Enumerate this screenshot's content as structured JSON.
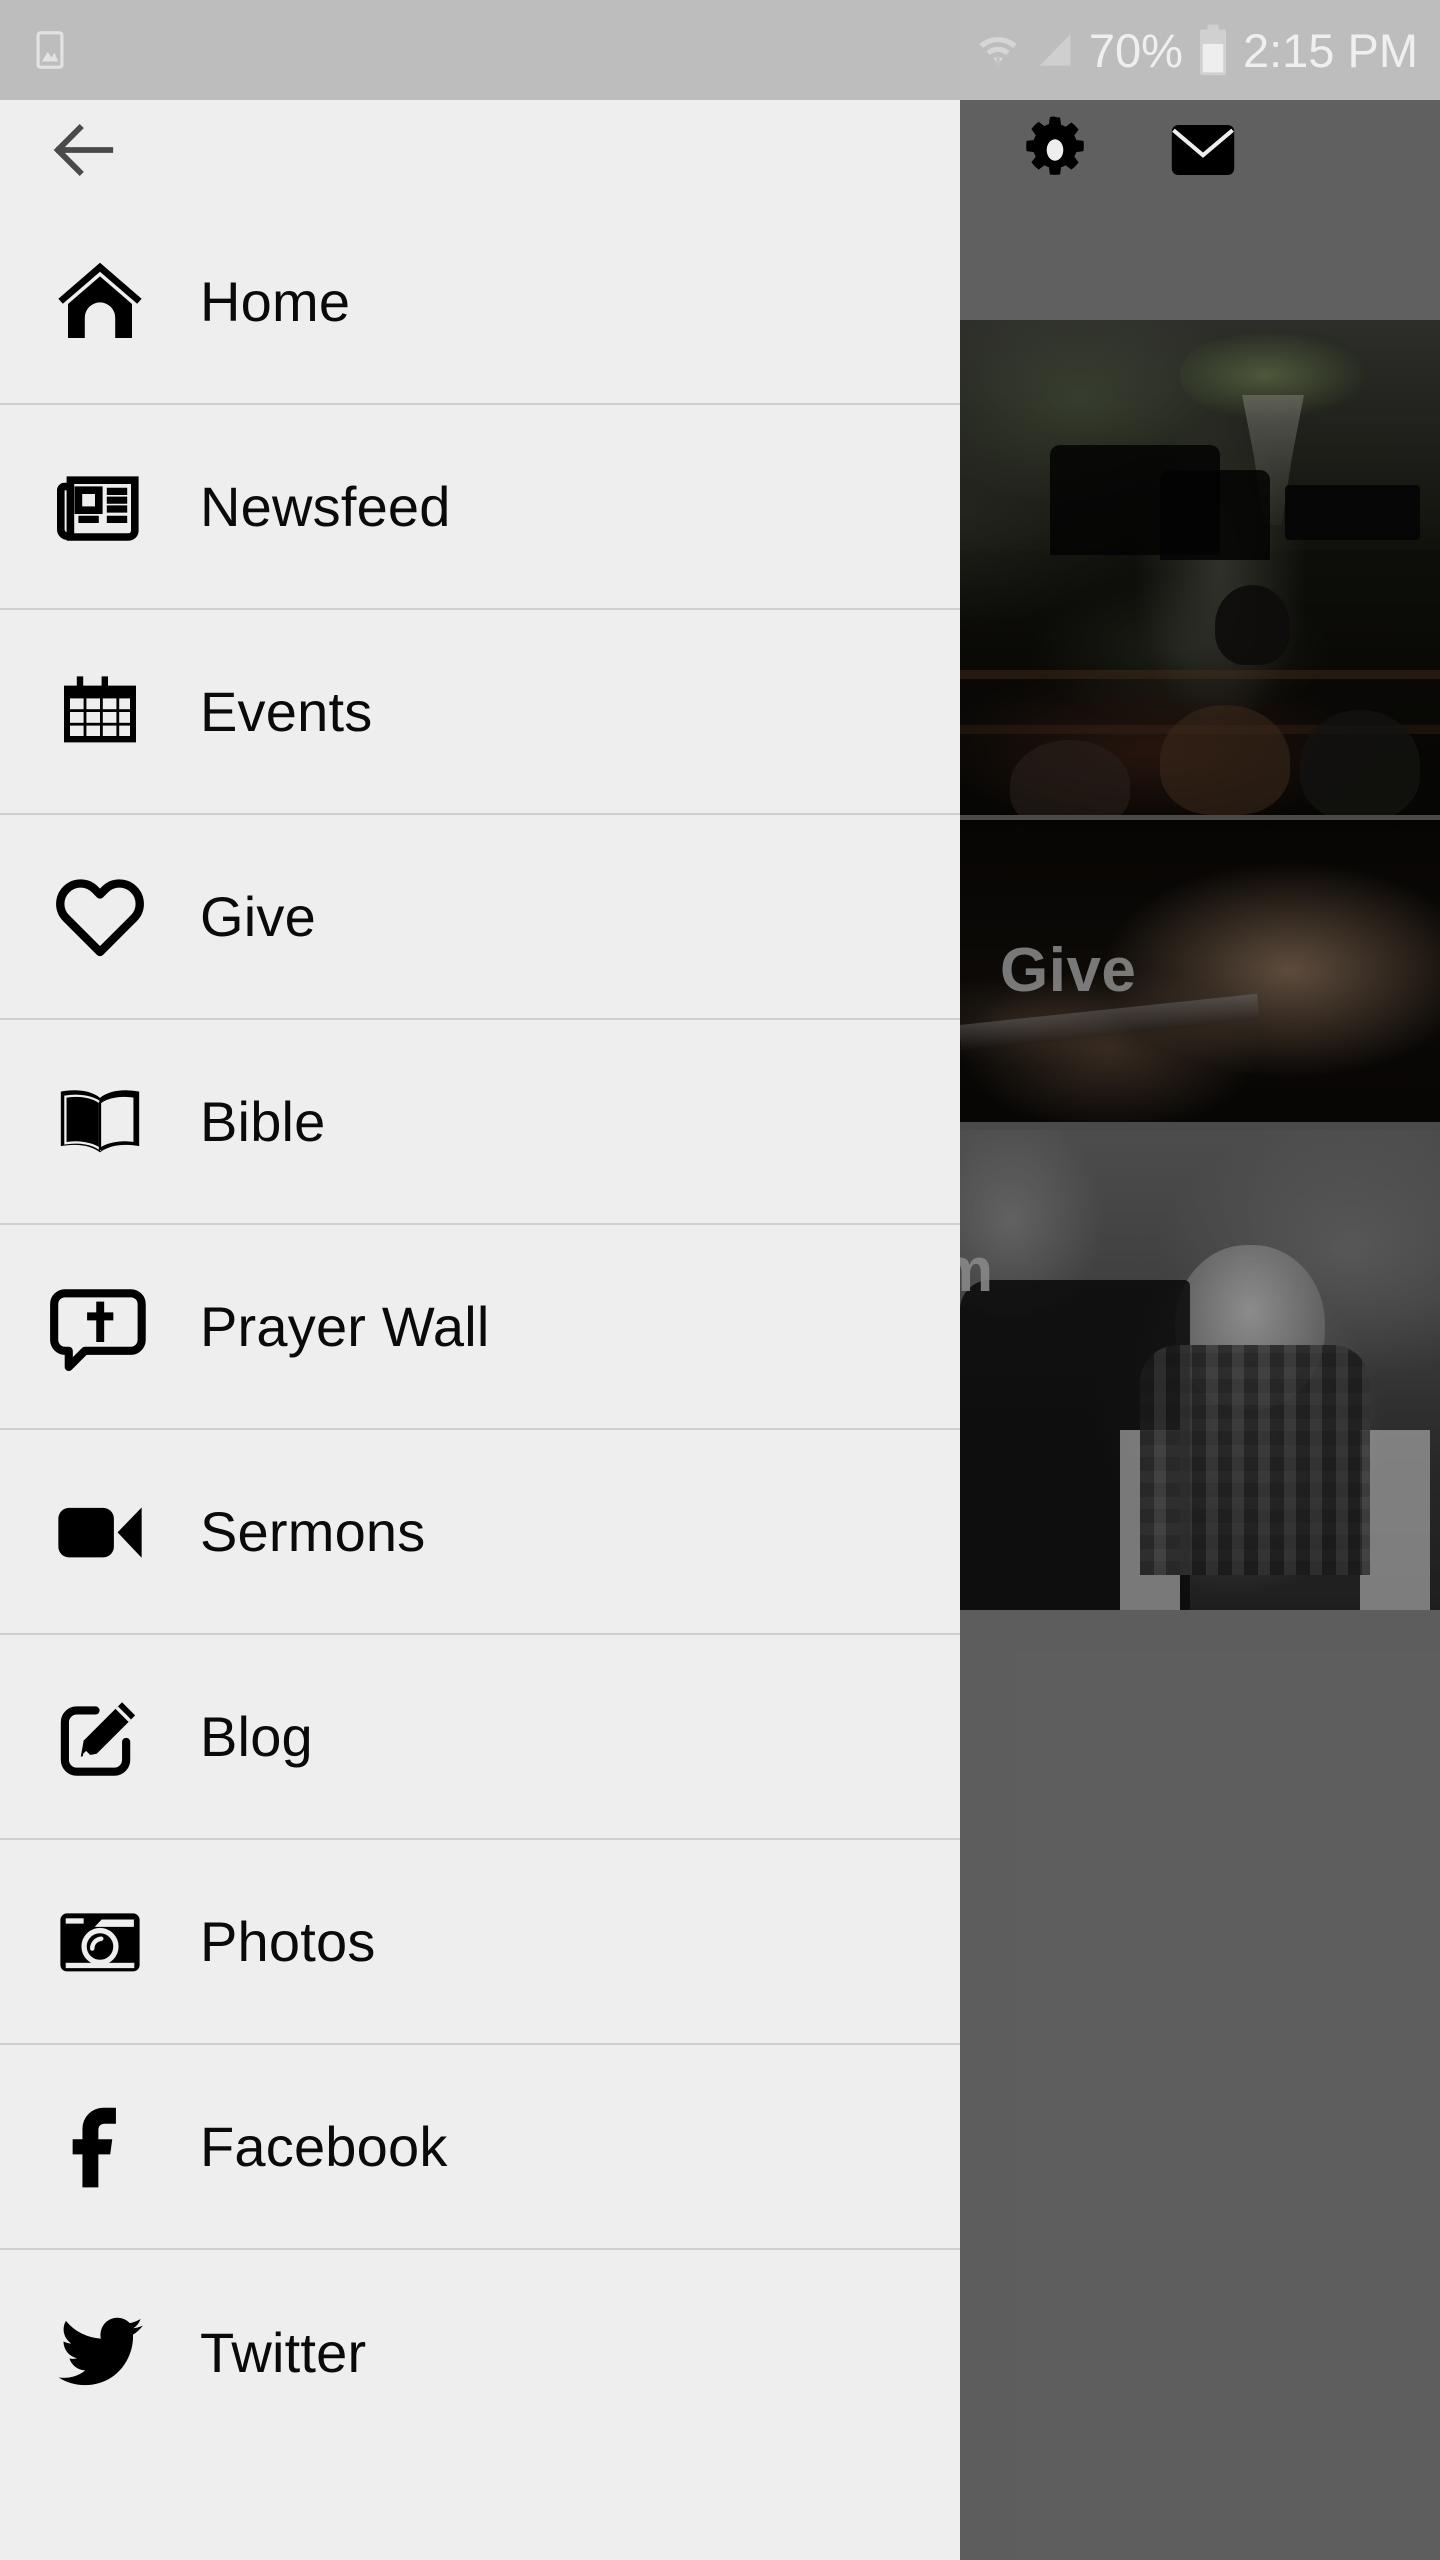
{
  "status_bar": {
    "left_icons": [
      {
        "name": "photo-gallery-icon",
        "glyph": "image"
      }
    ],
    "right_icons": [
      {
        "name": "wifi-icon"
      },
      {
        "name": "cellular-signal-icon"
      },
      {
        "name": "battery-icon"
      }
    ],
    "battery_percent": "70%",
    "time": "2:15 PM",
    "background_color": "#bdbdbd",
    "text_color": "#efefef"
  },
  "app_bar": {
    "background_color": "#eeeeee",
    "back_button": {
      "name": "back-arrow-icon",
      "label": "Back"
    },
    "actions": [
      {
        "name": "settings-gear-icon",
        "label": "Settings"
      },
      {
        "name": "mail-envelope-icon",
        "label": "Messages"
      }
    ]
  },
  "drawer": {
    "background_color": "#eeeeee",
    "divider_color": "#cfcfcf",
    "label_color": "#0a0a0a",
    "items": [
      {
        "label": "Home",
        "icon": "home-icon"
      },
      {
        "label": "Newsfeed",
        "icon": "newspaper-icon"
      },
      {
        "label": "Events",
        "icon": "calendar-icon"
      },
      {
        "label": "Give",
        "icon": "heart-icon"
      },
      {
        "label": "Bible",
        "icon": "open-book-icon"
      },
      {
        "label": "Prayer Wall",
        "icon": "speech-bubble-cross-icon"
      },
      {
        "label": "Sermons",
        "icon": "video-camera-icon"
      },
      {
        "label": "Blog",
        "icon": "pencil-square-icon"
      },
      {
        "label": "Photos",
        "icon": "camera-icon"
      },
      {
        "label": "Facebook",
        "icon": "facebook-icon"
      },
      {
        "label": "Twitter",
        "icon": "twitter-bird-icon"
      }
    ]
  },
  "background_panel": {
    "scrim_color": "rgba(0,0,0,0.30)",
    "tiles": [
      {
        "name": "sanctuary-tile",
        "label": "",
        "description": "church sanctuary photo"
      },
      {
        "name": "give-tile",
        "label": "Give",
        "description": "hands holding phone photo"
      },
      {
        "name": "family-tile",
        "label": "m",
        "description": "father and child photo"
      }
    ],
    "footer_color": "#868686"
  }
}
